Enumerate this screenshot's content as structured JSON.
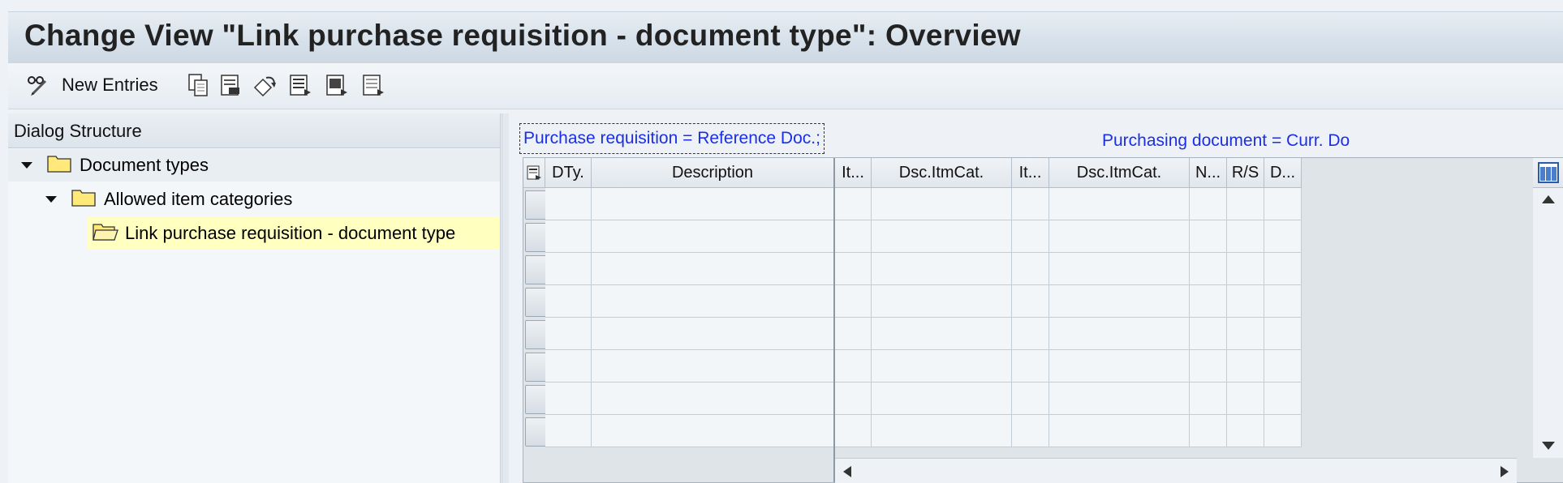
{
  "window": {
    "title": "Change View \"Link purchase requisition - document type\": Overview"
  },
  "toolbar": {
    "new_entries_label": "New Entries",
    "icons": [
      "glasses-pen-icon",
      "copy-icon",
      "delete-icon",
      "undo-icon",
      "select-all-icon",
      "select-block-icon",
      "deselect-all-icon"
    ]
  },
  "dialog_structure": {
    "header": "Dialog Structure",
    "items": [
      {
        "label": "Document types",
        "level": 1,
        "expanded": true
      },
      {
        "label": "Allowed item categories",
        "level": 2,
        "expanded": true
      },
      {
        "label": "Link purchase requisition - document type",
        "level": 3,
        "selected": true
      }
    ]
  },
  "main": {
    "left_group_header": "Purchase requisition = Reference Doc.;",
    "right_group_header": "Purchasing document = Curr. Do",
    "columns": [
      "DTy.",
      "Description",
      "It...",
      "Dsc.ItmCat.",
      "It...",
      "Dsc.ItmCat.",
      "N...",
      "R/S",
      "D..."
    ],
    "row_count": 8
  },
  "colors": {
    "link_blue": "#1a2fe6",
    "selected_bg": "#ffffc0"
  }
}
